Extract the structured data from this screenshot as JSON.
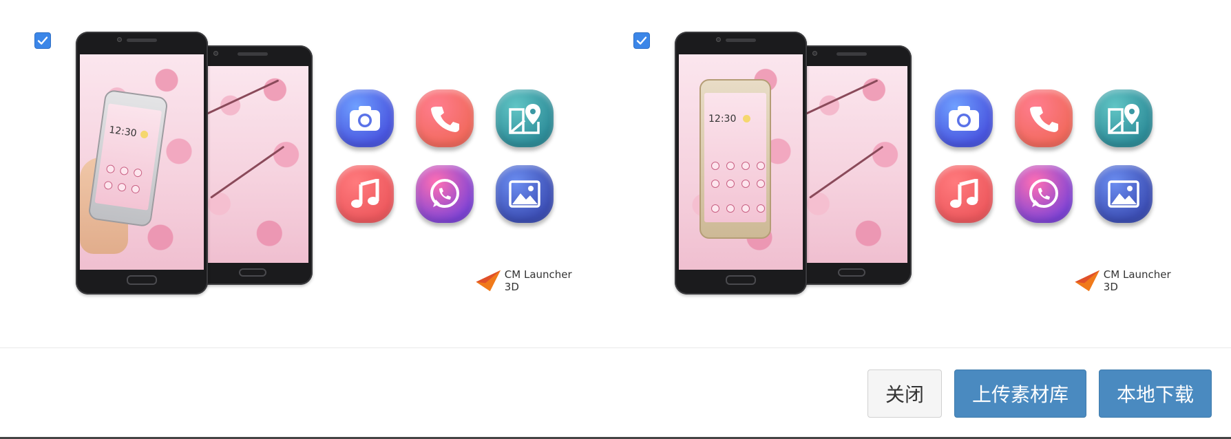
{
  "cards": [
    {
      "selected": true,
      "brand": "CM Launcher 3D",
      "preview_time": "12:30",
      "app_icons": [
        "camera-icon",
        "phone-icon",
        "maps-icon",
        "music-icon",
        "whatsapp-icon",
        "gallery-icon"
      ]
    },
    {
      "selected": true,
      "brand": "CM Launcher 3D",
      "preview_time": "12:30",
      "app_icons": [
        "camera-icon",
        "phone-icon",
        "maps-icon",
        "music-icon",
        "whatsapp-icon",
        "gallery-icon"
      ]
    }
  ],
  "footer": {
    "close_label": "关闭",
    "upload_label": "上传素材库",
    "download_label": "本地下载"
  },
  "colors": {
    "checkbox": "#3b86e8",
    "primary_button": "#4a8ac0",
    "secondary_button": "#f5f5f5"
  }
}
